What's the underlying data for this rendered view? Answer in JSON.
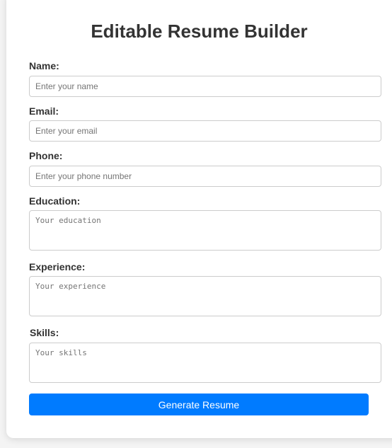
{
  "page": {
    "title": "Editable Resume Builder"
  },
  "form": {
    "name": {
      "label": "Name:",
      "placeholder": "Enter your name",
      "value": ""
    },
    "email": {
      "label": "Email:",
      "placeholder": "Enter your email",
      "value": ""
    },
    "phone": {
      "label": "Phone:",
      "placeholder": "Enter your phone number",
      "value": ""
    },
    "education": {
      "label": "Education:",
      "placeholder": "Your education",
      "value": ""
    },
    "experience": {
      "label": "Experience:",
      "placeholder": "Your experience",
      "value": ""
    },
    "skills": {
      "label": "Skills:",
      "placeholder": "Your skills",
      "value": ""
    },
    "submit_label": "Generate Resume"
  },
  "colors": {
    "accent": "#007bff",
    "text": "#333333",
    "border": "#cccccc",
    "background": "#f4f4f4",
    "card": "#ffffff"
  }
}
